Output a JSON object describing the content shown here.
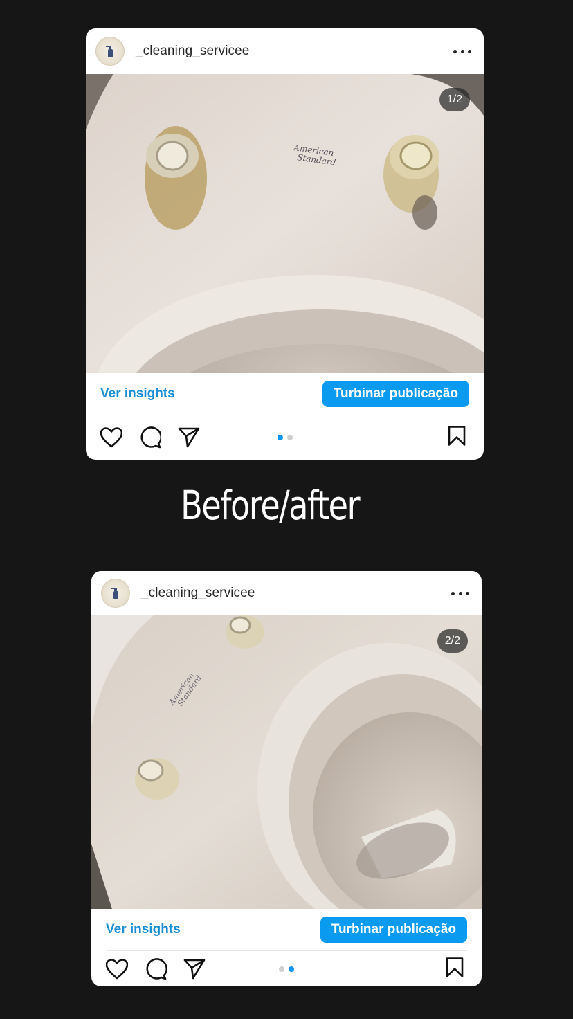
{
  "posts": [
    {
      "username": "_cleaning_servicee",
      "counter": "1/2",
      "insights_label": "Ver insights",
      "boost_label": "Turbinar publicação",
      "active_dot": 0,
      "photo_brand": "American Standard"
    },
    {
      "username": "_cleaning_servicee",
      "counter": "2/2",
      "insights_label": "Ver insights",
      "boost_label": "Turbinar publicação",
      "active_dot": 1,
      "photo_brand": "American Standard"
    }
  ],
  "caption": "Before/after",
  "colors": {
    "background": "#161616",
    "accent": "#0a9af0",
    "link": "#1a8fd6"
  },
  "icons": [
    "heart-icon",
    "comment-icon",
    "share-icon",
    "bookmark-icon",
    "more-icon"
  ]
}
